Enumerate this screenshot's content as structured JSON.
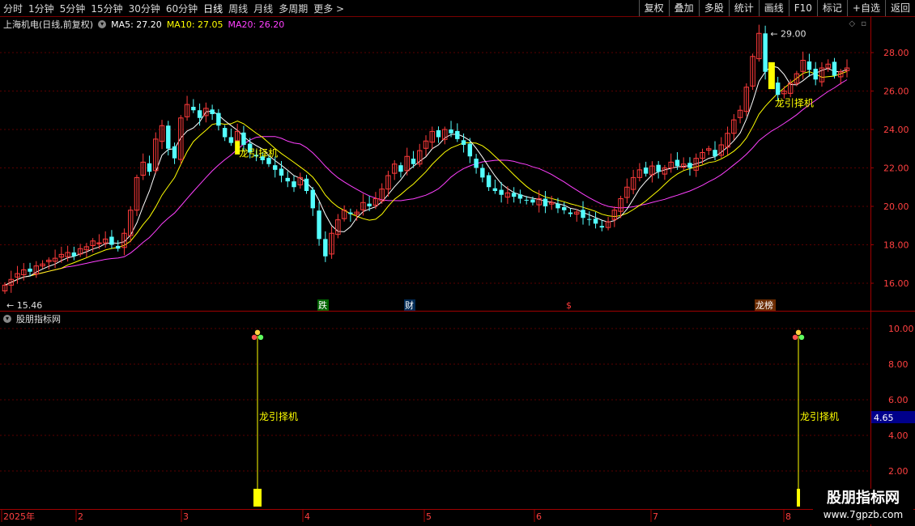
{
  "toolbar": {
    "periods": [
      "分时",
      "1分钟",
      "5分钟",
      "15分钟",
      "30分钟",
      "60分钟",
      "日线",
      "周线",
      "月线",
      "多周期",
      "更多 >"
    ],
    "active_period": "日线",
    "buttons": [
      "复权",
      "叠加",
      "多股",
      "统计",
      "画线",
      "F10",
      "标记",
      "+自选",
      "返回"
    ]
  },
  "main_panel": {
    "title": "上海机电(日线,前复权)",
    "ma5": "MA5: 27.20",
    "ma10": "MA10: 27.05",
    "ma20": "MA20: 26.20",
    "ma5_color": "#ffffff",
    "ma10_color": "#ffff00",
    "ma20_color": "#ff40ff",
    "high_label": "29.00",
    "low_label": "15.46",
    "price_ticks": [
      "28.00",
      "26.00",
      "24.00",
      "22.00",
      "20.00",
      "18.00",
      "16.00"
    ],
    "signal_text": "龙引择机",
    "event_markers": [
      "跌",
      "财",
      "$",
      "龙榜"
    ]
  },
  "sub_panel": {
    "title": "股朋指标网",
    "ticks": [
      "10.00",
      "8.00",
      "6.00",
      "4.00",
      "2.00"
    ],
    "current_value": "4.65",
    "signal_text": "龙引择机"
  },
  "date_axis": [
    "2025年",
    "2",
    "3",
    "4",
    "5",
    "6",
    "7",
    "8"
  ],
  "brand": {
    "name": "股朋指标网",
    "url": "www.7gpzb.com"
  },
  "colors": {
    "up": "#ff3b3b",
    "down": "#54ffff",
    "signal": "#ffff00",
    "grid": "#5a0000",
    "axis_text": "#ff4040"
  }
}
